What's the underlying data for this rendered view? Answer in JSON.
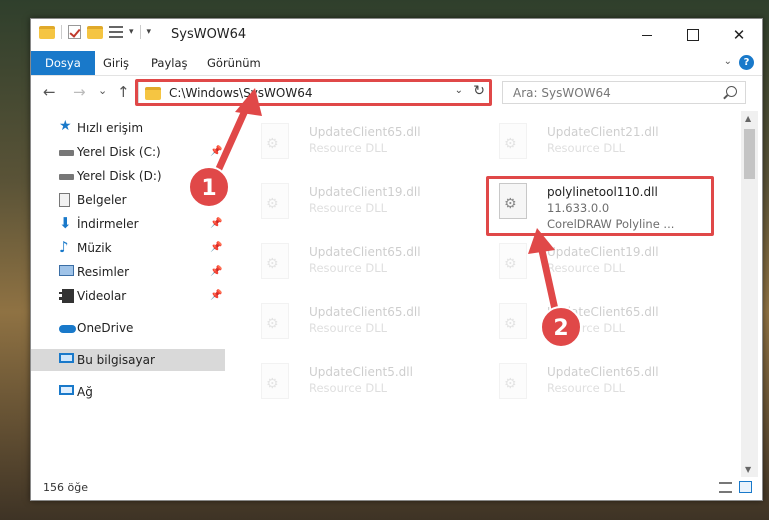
{
  "window": {
    "title": "SysWOW64",
    "controls": {
      "minimize": "–",
      "maximize": "□",
      "close": "✕"
    }
  },
  "ribbon": {
    "tabs": [
      "Dosya",
      "Giriş",
      "Paylaş",
      "Görünüm"
    ],
    "help": "?"
  },
  "navbar": {
    "back": "←",
    "forward": "→",
    "recent": "⌄",
    "up": "↑",
    "address": "C:\\Windows\\SysWOW64",
    "refresh": "↻",
    "search_placeholder": "Ara: SysWOW64"
  },
  "nav_pane": {
    "items": [
      {
        "label": "Hızlı erişim",
        "icon": "star-icon"
      },
      {
        "label": "Yerel Disk (C:)",
        "icon": "drive-icon",
        "pinned": true
      },
      {
        "label": "Yerel Disk (D:)",
        "icon": "drive-icon",
        "pinned": false
      },
      {
        "label": "Belgeler",
        "icon": "documents-icon",
        "pinned": true
      },
      {
        "label": "İndirmeler",
        "icon": "downloads-icon",
        "pinned": true
      },
      {
        "label": "Müzik",
        "icon": "music-icon",
        "pinned": true
      },
      {
        "label": "Resimler",
        "icon": "pictures-icon",
        "pinned": true
      },
      {
        "label": "Videolar",
        "icon": "videos-icon",
        "pinned": true
      },
      {
        "label": "OneDrive",
        "icon": "onedrive-icon"
      },
      {
        "label": "Bu bilgisayar",
        "icon": "this-pc-icon",
        "selected": true
      },
      {
        "label": "Ağ",
        "icon": "network-icon"
      }
    ]
  },
  "files": [
    {
      "name": "UpdateClient65.dll",
      "subtitle": "Resource DLL",
      "faded": true
    },
    {
      "name": "UpdateClient21.dll",
      "subtitle": "Resource DLL",
      "faded": true
    },
    {
      "name": "UpdateClient19.dll",
      "subtitle": "Resource DLL",
      "faded": true
    },
    {
      "name": "polylinetool110.dll",
      "subtitle": "11.633.0.0",
      "description": "CorelDRAW Polyline ...",
      "faded": false
    },
    {
      "name": "UpdateClient65.dll",
      "subtitle": "Resource DLL",
      "faded": true
    },
    {
      "name": "UpdateClient19.dll",
      "subtitle": "Resource DLL",
      "faded": true
    },
    {
      "name": "UpdateClient65.dll",
      "subtitle": "Resource DLL",
      "faded": true
    },
    {
      "name": "UpdateClient65.dll",
      "subtitle": "Resource DLL",
      "faded": true
    },
    {
      "name": "UpdateClient5.dll",
      "subtitle": "Resource DLL",
      "faded": true
    },
    {
      "name": "UpdateClient65.dll",
      "subtitle": "Resource DLL",
      "faded": true
    }
  ],
  "status": {
    "item_count": "156 öğe"
  },
  "annotations": {
    "badge1": "1",
    "badge2": "2",
    "color": "#e04848"
  }
}
